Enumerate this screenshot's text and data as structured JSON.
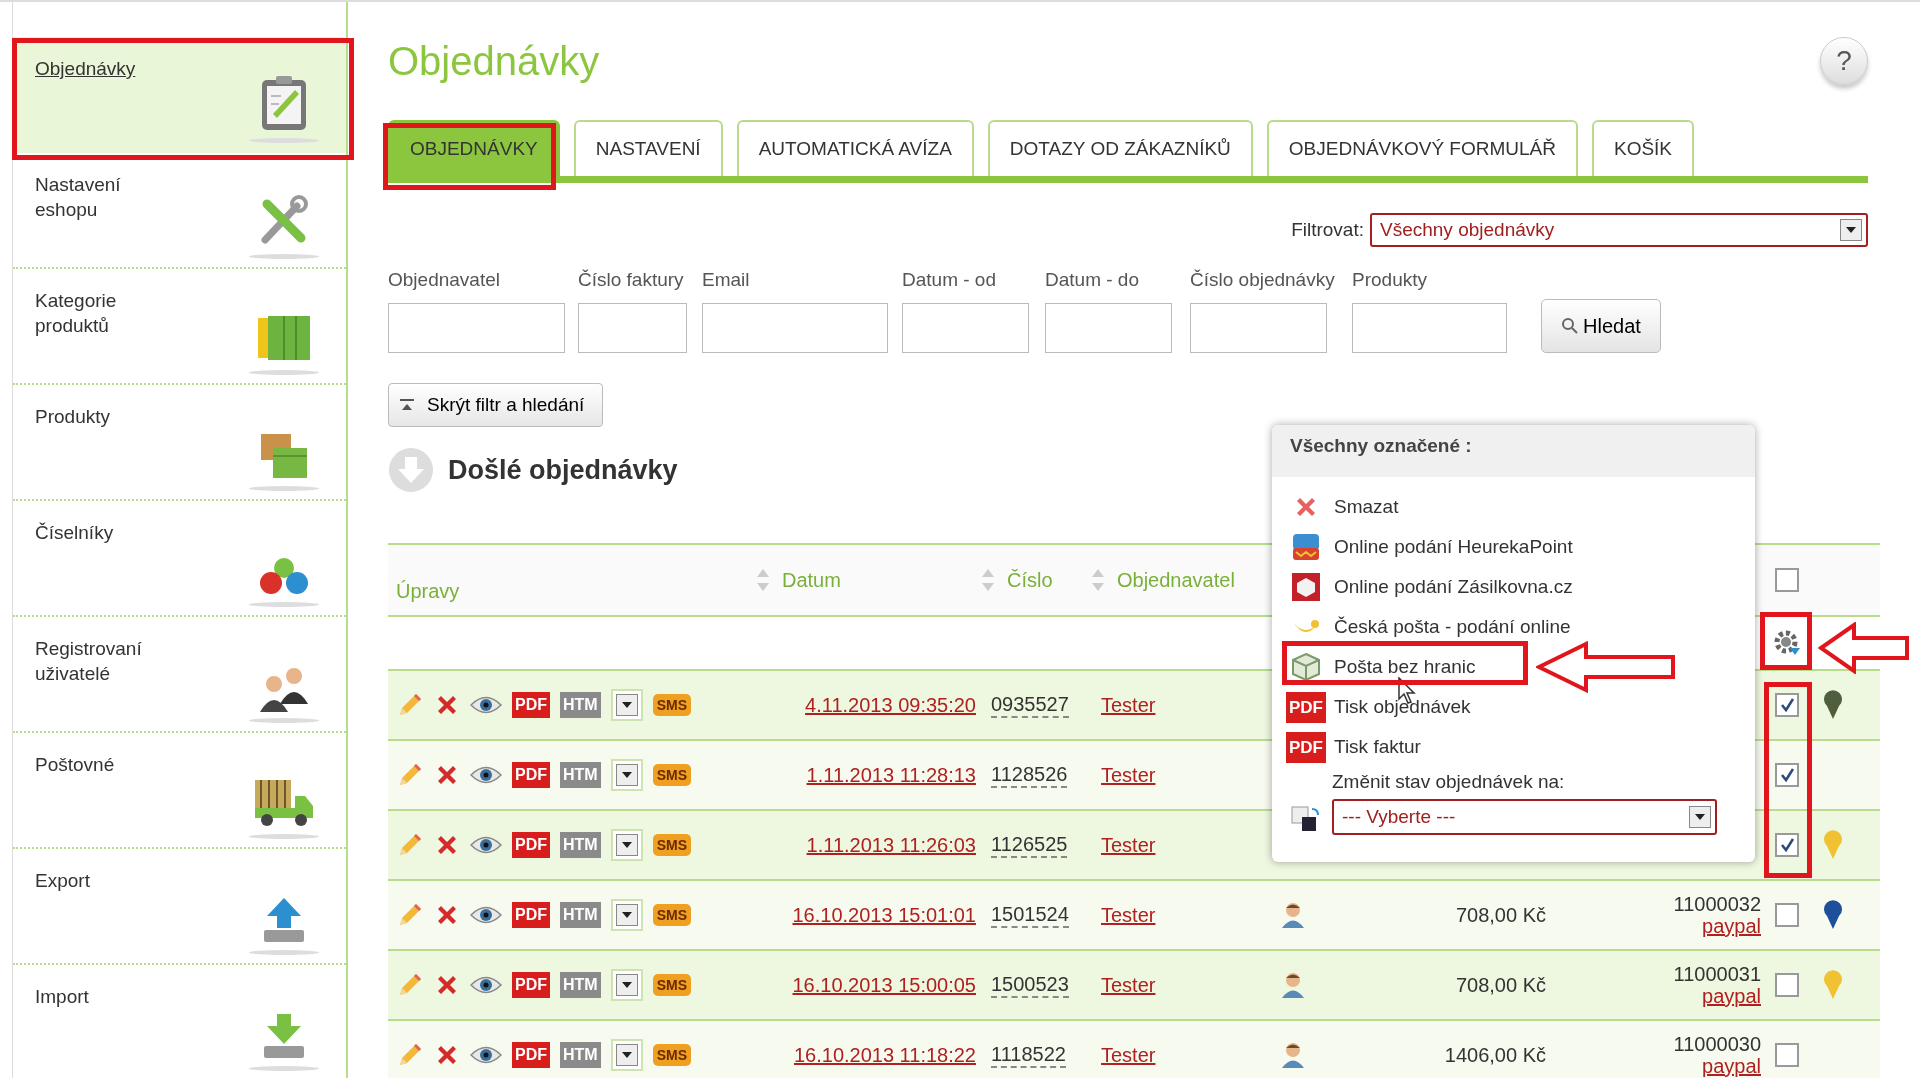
{
  "sidebar": {
    "items": [
      {
        "label": "Objednávky",
        "selected": true
      },
      {
        "label": "Nastavení eshopu",
        "selected": false
      },
      {
        "label": "Kategorie produktů",
        "selected": false
      },
      {
        "label": "Produkty",
        "selected": false
      },
      {
        "label": "Číselníky",
        "selected": false
      },
      {
        "label": "Registrovaní uživatelé",
        "selected": false
      },
      {
        "label": "Poštovné",
        "selected": false
      },
      {
        "label": "Export",
        "selected": false
      },
      {
        "label": "Import",
        "selected": false
      }
    ]
  },
  "page": {
    "title": "Objednávky",
    "help": "?"
  },
  "tabs": [
    {
      "label": "OBJEDNÁVKY",
      "selected": true
    },
    {
      "label": "NASTAVENÍ",
      "selected": false
    },
    {
      "label": "AUTOMATICKÁ AVÍZA",
      "selected": false
    },
    {
      "label": "DOTAZY OD ZÁKAZNÍKŮ",
      "selected": false
    },
    {
      "label": "OBJEDNÁVKOVÝ FORMULÁŘ",
      "selected": false
    },
    {
      "label": "KOŠÍK",
      "selected": false
    }
  ],
  "filter": {
    "label": "Filtrovat:",
    "value": "Všechny objednávky"
  },
  "search": {
    "fields": [
      {
        "label": "Objednavatel"
      },
      {
        "label": "Číslo faktury"
      },
      {
        "label": "Email"
      },
      {
        "label": "Datum - od"
      },
      {
        "label": "Datum - do"
      },
      {
        "label": "Číslo objednávky"
      },
      {
        "label": "Produkty"
      }
    ],
    "button": "Hledat"
  },
  "toggle_button": "Skrýt filtr a hledání",
  "section_title": "Došlé objednávky",
  "table": {
    "columns": [
      "Úpravy",
      "Datum",
      "Číslo",
      "Objednavatel"
    ],
    "select_all_checked": false,
    "rows": [
      {
        "pdf": "PDF",
        "htm": "HTM",
        "sms": "SMS",
        "date": "4.11.2013 09:35:20",
        "number": "0935527",
        "customer": "Tester",
        "checked": true,
        "color": "#4f5e3c"
      },
      {
        "pdf": "PDF",
        "htm": "HTM",
        "sms": "SMS",
        "date": "1.11.2013 11:28:13",
        "number": "1128526",
        "customer": "Tester",
        "checked": true
      },
      {
        "pdf": "PDF",
        "htm": "HTM",
        "sms": "SMS",
        "date": "1.11.2013 11:26:03",
        "number": "1126525",
        "customer": "Tester",
        "checked": true,
        "color": "#f0c233"
      },
      {
        "pdf": "PDF",
        "htm": "HTM",
        "sms": "SMS",
        "date": "16.10.2013 15:01:01",
        "number": "1501524",
        "customer": "Tester",
        "price": "708,00 Kč",
        "invoice": "11000032",
        "payment": "paypal",
        "checked": false,
        "color": "#1d4f9c"
      },
      {
        "pdf": "PDF",
        "htm": "HTM",
        "sms": "SMS",
        "date": "16.10.2013 15:00:05",
        "number": "1500523",
        "customer": "Tester",
        "price": "708,00 Kč",
        "invoice": "11000031",
        "payment": "paypal",
        "checked": false,
        "color": "#f0c233"
      },
      {
        "pdf": "PDF",
        "htm": "HTM",
        "sms": "SMS",
        "date": "16.10.2013 11:18:22",
        "number": "1118522",
        "customer": "Tester",
        "price": "1406,00 Kč",
        "invoice": "11000030",
        "payment": "paypal",
        "checked": false
      }
    ]
  },
  "popup": {
    "title": "Všechny označené :",
    "actions": [
      {
        "label": "Smazat"
      },
      {
        "label": "Online podání HeurekaPoint"
      },
      {
        "label": "Online podání Zásilkovna.cz"
      },
      {
        "label": "Česká pošta - podání online"
      },
      {
        "label": "Pošta bez hranic"
      },
      {
        "label": "Tisk objednávek",
        "badge": "PDF"
      },
      {
        "label": "Tisk faktur",
        "badge": "PDF"
      }
    ],
    "status_label": "Změnit stav objednávek na:",
    "status_value": "--- Vyberte ---"
  }
}
